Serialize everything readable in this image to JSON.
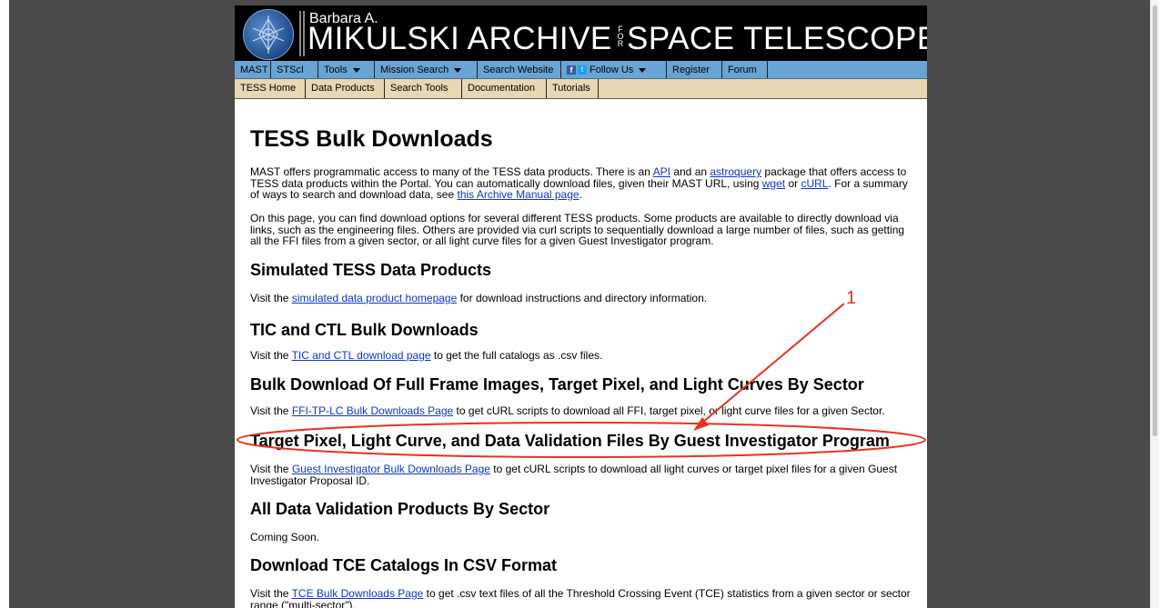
{
  "banner": {
    "small": "Barbara A.",
    "big_left": "MIKULSKI ARCHIVE",
    "for_text": [
      "F",
      "O",
      "R"
    ],
    "big_right": "SPACE TELESCOPES"
  },
  "nav_primary": [
    {
      "label": "MAST"
    },
    {
      "label": "STScI"
    },
    {
      "label": "Tools"
    },
    {
      "label": "Mission Search"
    },
    {
      "label": "Search Website"
    },
    {
      "label": "Follow Us"
    },
    {
      "label": "Register"
    },
    {
      "label": "Forum"
    }
  ],
  "nav_secondary": [
    {
      "label": "TESS Home"
    },
    {
      "label": "Data Products"
    },
    {
      "label": "Search Tools"
    },
    {
      "label": "Documentation"
    },
    {
      "label": "Tutorials"
    }
  ],
  "content": {
    "title": "TESS Bulk Downloads",
    "intro1": {
      "t1": "MAST offers programmatic access to many of the TESS data products. There is an ",
      "l1": "API",
      "t2": " and an ",
      "l2": "astroquery",
      "t3": " package that offers access to TESS data products within the Portal. You can automatically download files, given their MAST URL, using ",
      "l3": "wget",
      "t4": " or ",
      "l4": "cURL",
      "t5": ". For a summary of ways to search and download data, see ",
      "l5": "this Archive Manual page",
      "t6": "."
    },
    "intro2": "On this page, you can find download options for several different TESS products. Some products are available to directly download via links, such as the engineering files. Others are provided via curl scripts to sequentially download a large number of files, such as getting all the FFI files from a given sector, or all light curve files for a given Guest Investigator program.",
    "sections": [
      {
        "heading": "Simulated TESS Data Products",
        "pre": "Visit the ",
        "link": "simulated data product homepage",
        "post": " for download instructions and directory information."
      },
      {
        "heading": "TIC and CTL Bulk Downloads",
        "pre": "Visit the ",
        "link": "TIC and CTL download page",
        "post": " to get the full catalogs as .csv files."
      },
      {
        "heading": "Bulk Download Of Full Frame Images, Target Pixel, and Light Curves By Sector",
        "pre": "Visit the ",
        "link": "FFI-TP-LC Bulk Downloads Page",
        "post": " to get cURL scripts to download all FFI, target pixel, or light curve files for a given Sector."
      },
      {
        "heading": "Target Pixel, Light Curve, and Data Validation Files By Guest Investigator Program",
        "pre": "Visit the ",
        "link": "Guest Investigator Bulk Downloads Page",
        "post": " to get cURL scripts to download all light curves or target pixel files for a given Guest Investigator Proposal ID."
      },
      {
        "heading": "All Data Validation Products By Sector",
        "text": "Coming Soon."
      },
      {
        "heading": "Download TCE Catalogs In CSV Format",
        "pre": "Visit the ",
        "link": "TCE Bulk Downloads Page",
        "post": " to get .csv text files of all the Threshold Crossing Event (TCE) statistics from a given sector or sector range (\"multi-sector\")."
      }
    ]
  },
  "annotation": {
    "label": "1",
    "color": "#e8321e"
  }
}
